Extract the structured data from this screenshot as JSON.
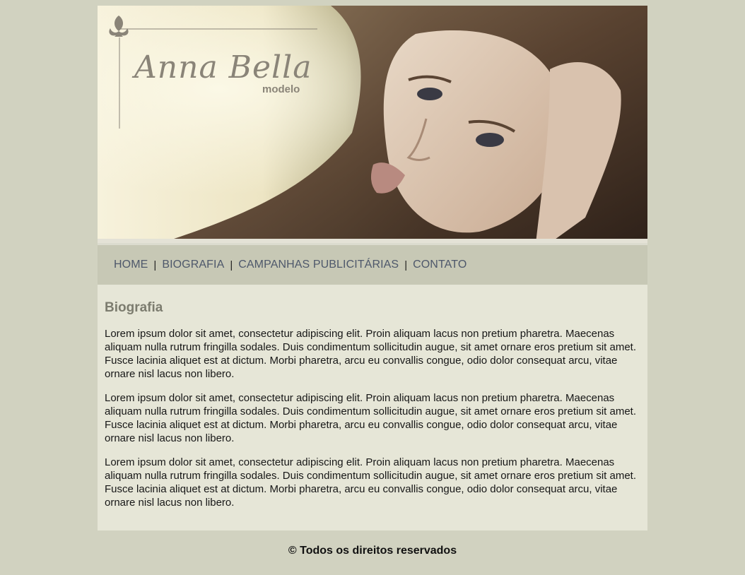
{
  "banner": {
    "title": "Anna Bella",
    "subtitle": "modelo"
  },
  "nav": {
    "items": [
      "HOME",
      "BIOGRAFIA",
      "CAMPANHAS PUBLICITÁRIAS",
      "CONTATO"
    ],
    "separator": "|"
  },
  "main": {
    "heading": "Biografia",
    "paragraphs": [
      "Lorem ipsum dolor sit amet, consectetur adipiscing elit. Proin aliquam lacus non pretium pharetra. Maecenas aliquam nulla rutrum fringilla sodales. Duis condimentum sollicitudin augue, sit amet ornare eros pretium sit amet. Fusce lacinia aliquet est at dictum. Morbi pharetra, arcu eu convallis congue, odio dolor consequat arcu, vitae ornare nisl lacus non libero.",
      "Lorem ipsum dolor sit amet, consectetur adipiscing elit. Proin aliquam lacus non pretium pharetra. Maecenas aliquam nulla rutrum fringilla sodales. Duis condimentum sollicitudin augue, sit amet ornare eros pretium sit amet. Fusce lacinia aliquet est at dictum. Morbi pharetra, arcu eu convallis congue, odio dolor consequat arcu, vitae ornare nisl lacus non libero.",
      "Lorem ipsum dolor sit amet, consectetur adipiscing elit. Proin aliquam lacus non pretium pharetra. Maecenas aliquam nulla rutrum fringilla sodales. Duis condimentum sollicitudin augue, sit amet ornare eros pretium sit amet. Fusce lacinia aliquet est at dictum. Morbi pharetra, arcu eu convallis congue, odio dolor consequat arcu, vitae ornare nisl lacus non libero."
    ]
  },
  "footer": {
    "text": "© Todos os direitos reservados"
  },
  "colors": {
    "page_background": "#d1d2c0",
    "nav_background": "#c7c8b5",
    "content_background": "#e6e6d7",
    "nav_link": "#4e586b",
    "heading": "#7c7c6f"
  }
}
